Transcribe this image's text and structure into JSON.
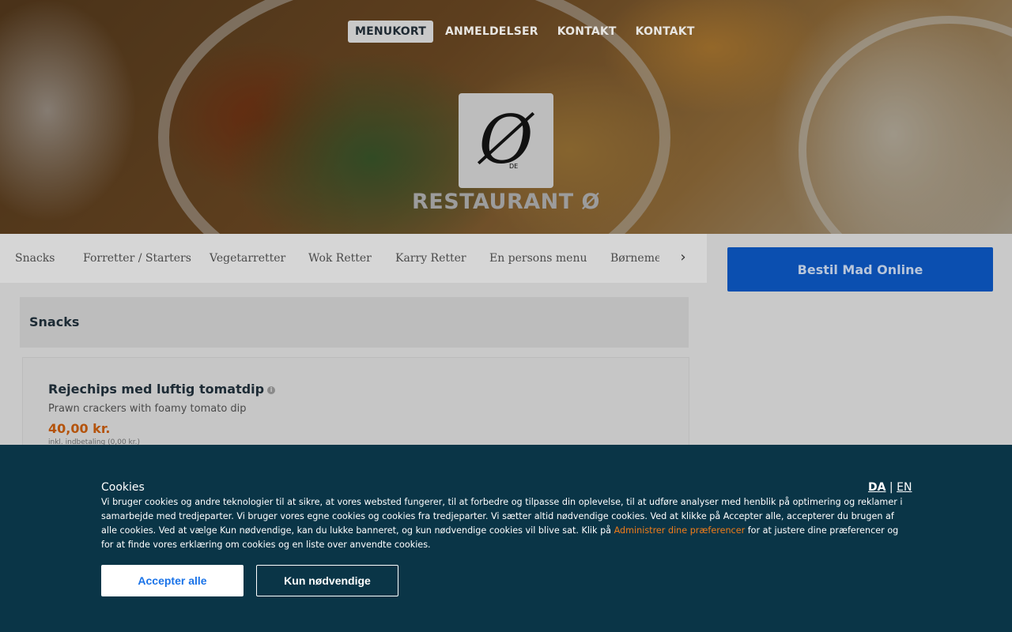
{
  "nav": {
    "items": [
      {
        "label": "MENUKORT",
        "active": true
      },
      {
        "label": "ANMELDELSER",
        "active": false
      },
      {
        "label": "KONTAKT",
        "active": false
      },
      {
        "label": "KONTAKT",
        "active": false
      }
    ]
  },
  "restaurant": {
    "logo_glyph": "Ø",
    "logo_sub": "DE",
    "name": "RESTAURANT Ø"
  },
  "categories": {
    "items": [
      "Snacks",
      "Forretter / Starters",
      "Vegetarretter",
      "Wok Retter",
      "Karry Retter",
      "En persons menu",
      "Børneme"
    ],
    "next_icon": "chevron-right-icon"
  },
  "order": {
    "button_label": "Bestil Mad Online",
    "color": "#0b4fb0"
  },
  "menu": {
    "section_title": "Snacks",
    "items": [
      {
        "name": "Rejechips med luftig tomatdip",
        "description": "Prawn crackers with foamy tomato dip",
        "price": "40,00 kr.",
        "deposit": "inkl. indbetaling (0,00 kr.)"
      }
    ],
    "price_color": "#b4530b"
  },
  "cookies": {
    "title": "Cookies",
    "lang_da": "DA",
    "lang_sep": "|",
    "lang_en": "EN",
    "text_before": "Vi bruger cookies og andre teknologier til at sikre, at vores websted fungerer, til at forbedre og tilpasse din oplevelse, til at udføre analyser med henblik på optimering og reklamer i samarbejde med tredjeparter. Vi bruger vores egne cookies og cookies fra tredjeparter. Vi sætter altid nødvendige cookies. Ved at klikke på Accepter alle, accepterer du brugen af alle cookies. Ved at vælge Kun nødvendige, kan du lukke banneret, og kun nødvendige cookies vil blive sat. Klik på ",
    "link_text": "Administrer dine præferencer",
    "text_after": " for at justere dine præferencer og for at finde vores erklæring om cookies og en liste over anvendte cookies.",
    "accept_label": "Accepter alle",
    "necessary_label": "Kun nødvendige",
    "background": "#0a3547",
    "link_color": "#f07d1a"
  }
}
